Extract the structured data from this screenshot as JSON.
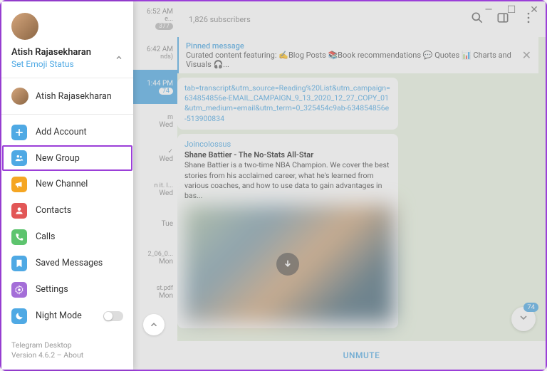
{
  "window": {
    "min": "—",
    "max": "☐",
    "close": "✕"
  },
  "profile": {
    "name": "Atish Rajasekharan",
    "status_link": "Set Emoji Status",
    "account_name": "Atish Rajasekharan"
  },
  "menu": {
    "add_account": "Add Account",
    "new_group": "New Group",
    "new_channel": "New Channel",
    "contacts": "Contacts",
    "calls": "Calls",
    "saved": "Saved Messages",
    "settings": "Settings",
    "night": "Night Mode"
  },
  "footer": {
    "app": "Telegram Desktop",
    "version": "Version 4.6.2 – About"
  },
  "chatlist": [
    {
      "time": "6:52 AM",
      "snippet": "e...",
      "badge": "377"
    },
    {
      "time": "6:42 AM",
      "snippet": "nds)"
    },
    {
      "time": "1:44 PM",
      "snippet": "...",
      "badge": "74",
      "active": true
    },
    {
      "time": "Wed",
      "snippet": "m"
    },
    {
      "time": "Wed",
      "snippet": "✓"
    },
    {
      "time": "Wed",
      "snippet": "n it. I..."
    },
    {
      "time": "Tue",
      "snippet": ""
    },
    {
      "time": "Mon",
      "snippet": "2_06_0..."
    },
    {
      "time": "Mon",
      "snippet": "st.pdf"
    }
  ],
  "header": {
    "subscribers": "1,826 subscribers"
  },
  "pinned": {
    "title": "Pinned message",
    "content": "Curated content featuring: ✍️Blog Posts 📚Book recommendations 💬 Quotes 📊 Charts and Visuals 🎧..."
  },
  "message": {
    "link_fragment": "tab=transcript&utm_source=Reading%20List&utm_campaign=634854856e-EMAIL_CAMPAIGN_9_13_2020_12_27_COPY_01&utm_medium=email&utm_term=0_325454c9ab-634854856e-513900834",
    "source": "Joincolossus",
    "title": "Shane Battier - The No-Stats All-Star",
    "body": "Shane Battier is a two-time NBA Champion. We cover the best stories from his acclaimed career, what he's learned from various coaches, and how to use data to gain advantages in bas..."
  },
  "actions": {
    "unmute": "UNMUTE",
    "scroll_badge": "74"
  }
}
